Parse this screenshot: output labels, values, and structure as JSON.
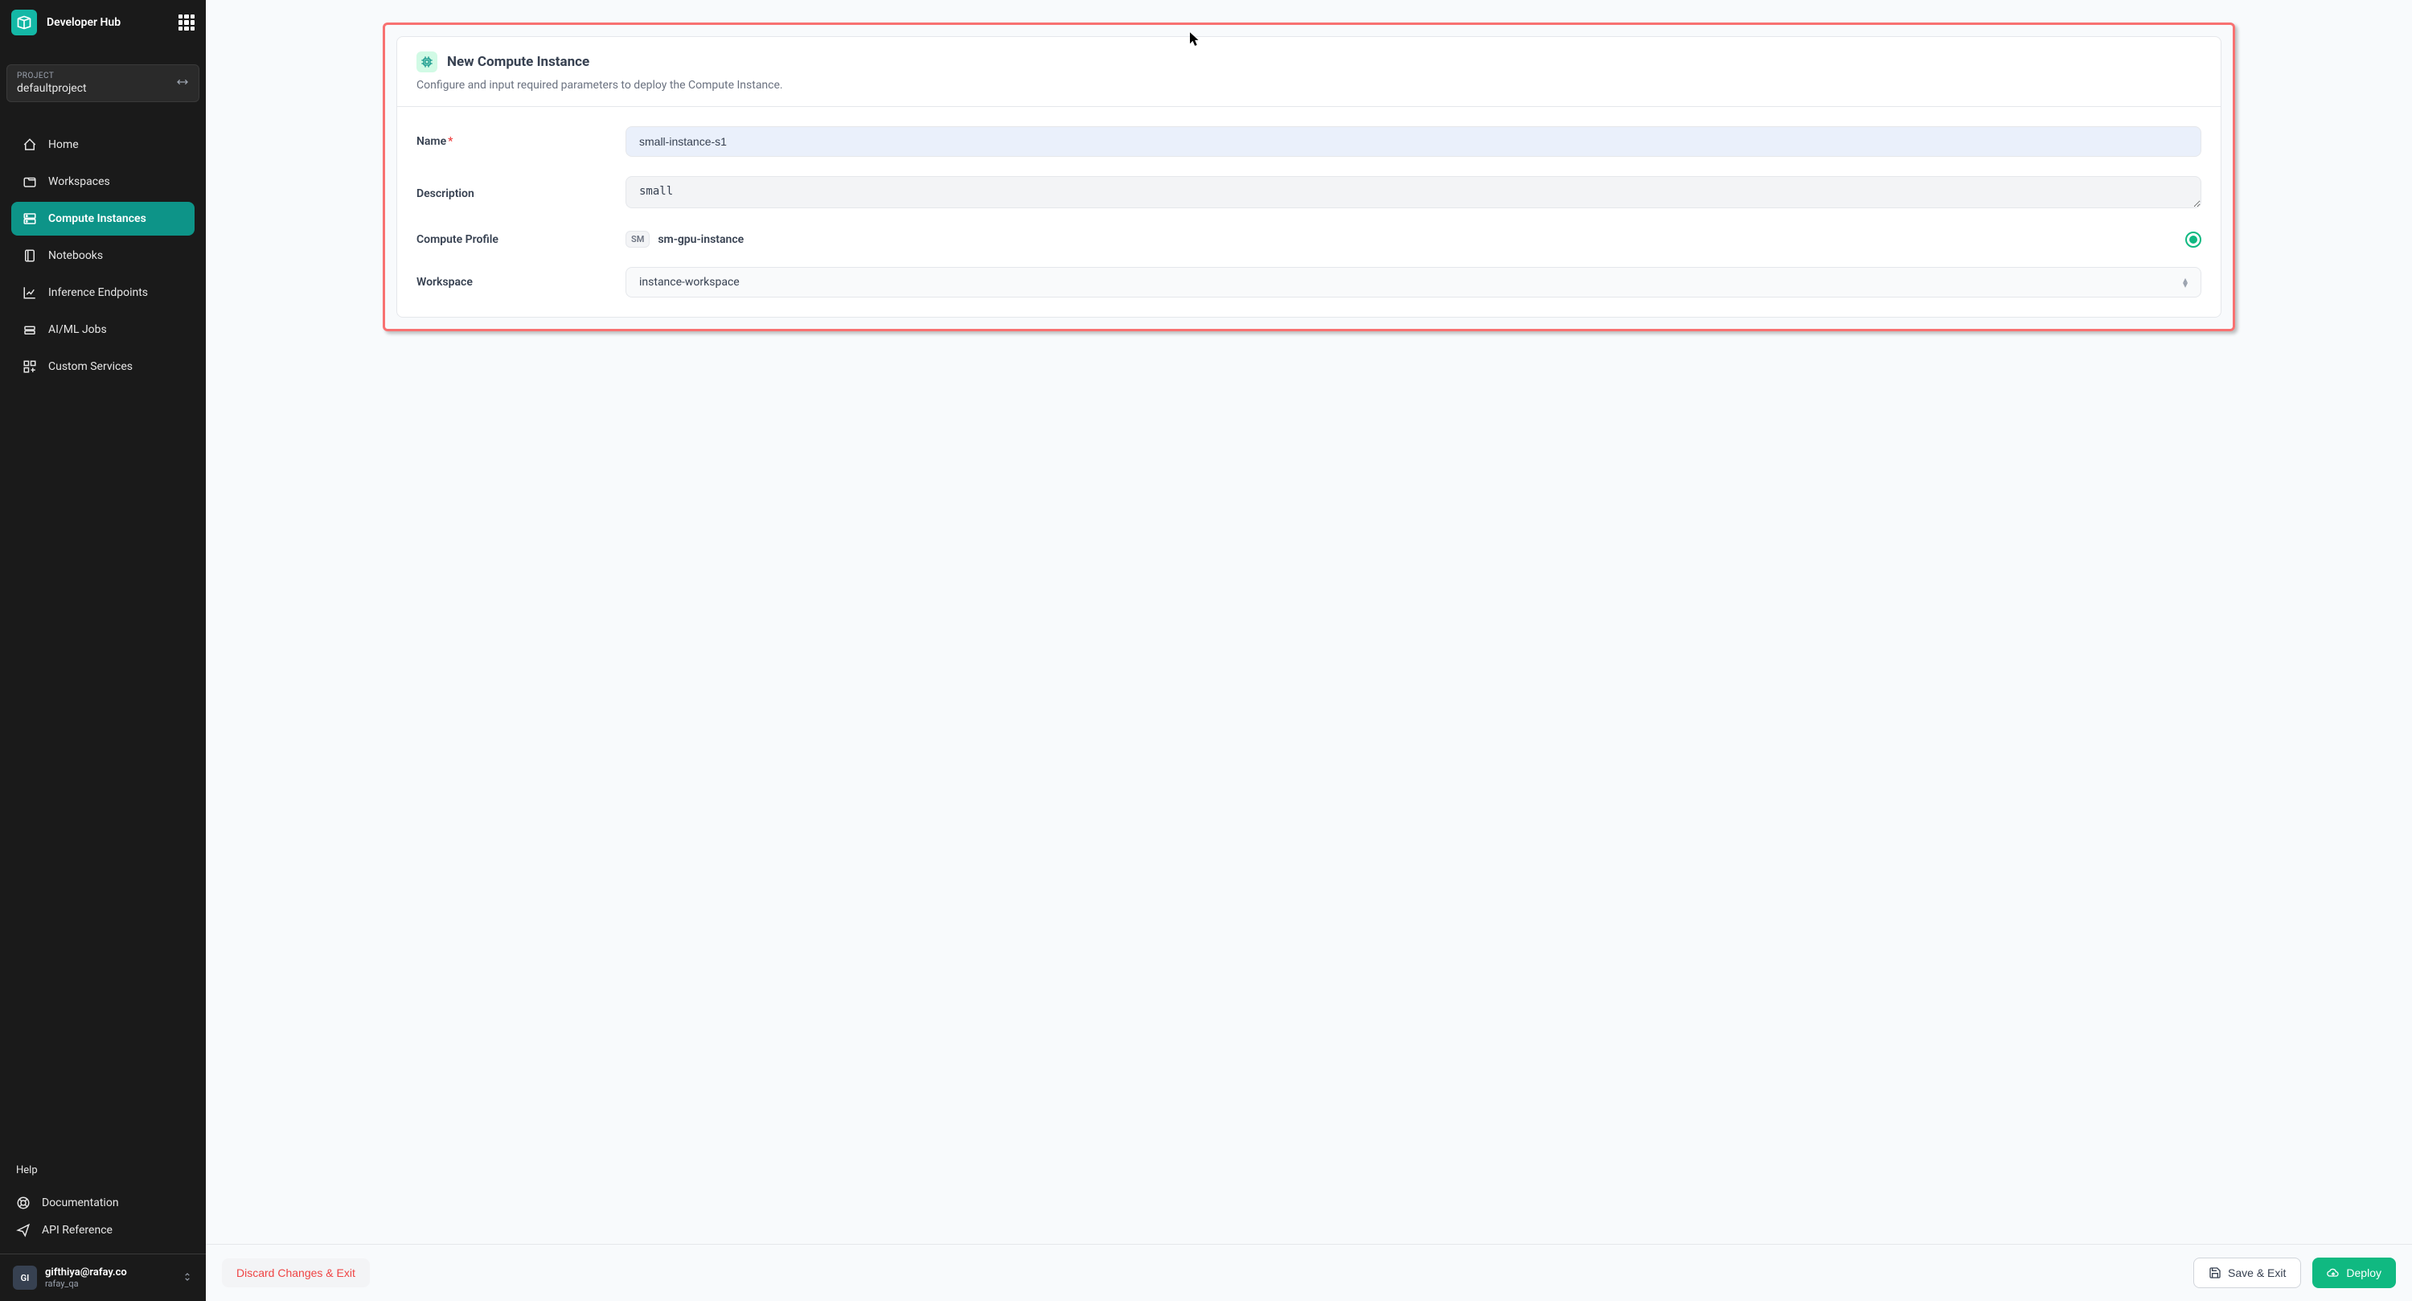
{
  "app": {
    "title": "Developer Hub"
  },
  "project": {
    "label": "PROJECT",
    "name": "defaultproject"
  },
  "nav": {
    "items": [
      {
        "label": "Home"
      },
      {
        "label": "Workspaces"
      },
      {
        "label": "Compute Instances"
      },
      {
        "label": "Notebooks"
      },
      {
        "label": "Inference Endpoints"
      },
      {
        "label": "AI/ML Jobs"
      },
      {
        "label": "Custom Services"
      }
    ]
  },
  "help": {
    "title": "Help",
    "doc": "Documentation",
    "api": "API Reference"
  },
  "user": {
    "initials": "GI",
    "email": "gifthiya@rafay.co",
    "org": "rafay_qa"
  },
  "form": {
    "title": "New Compute Instance",
    "subtitle": "Configure and input required parameters to deploy the Compute Instance.",
    "name_label": "Name",
    "name_value": "small-instance-s1",
    "desc_label": "Description",
    "desc_value": "small",
    "profile_label": "Compute Profile",
    "profile_badge": "SM",
    "profile_value": "sm-gpu-instance",
    "workspace_label": "Workspace",
    "workspace_value": "instance-workspace"
  },
  "footer": {
    "discard": "Discard Changes & Exit",
    "save": "Save & Exit",
    "deploy": "Deploy"
  }
}
